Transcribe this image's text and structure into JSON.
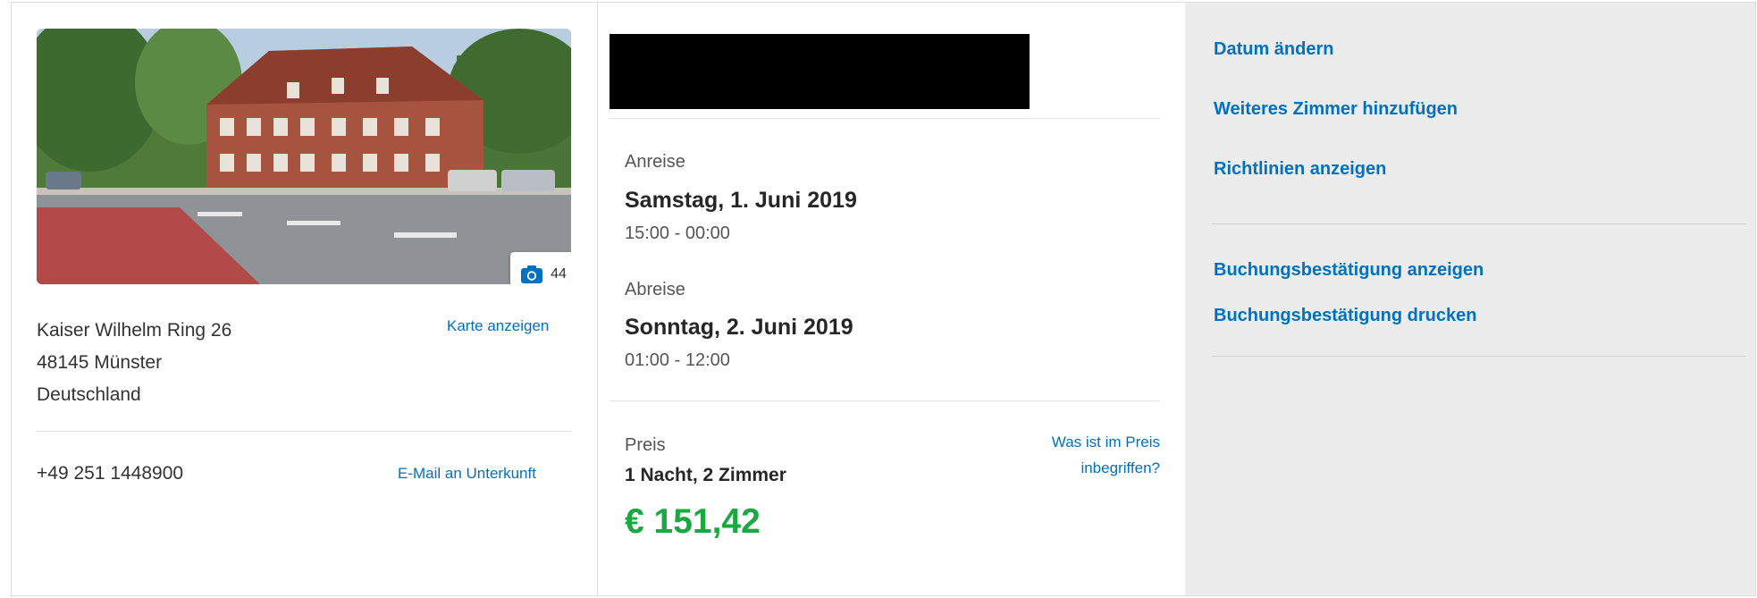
{
  "property": {
    "photo_count": "44",
    "address_lines": [
      "Kaiser Wilhelm Ring 26",
      "48145 Münster",
      "Deutschland"
    ],
    "map_link": "Karte anzeigen",
    "phone": "+49 251 1448900",
    "email_link": "E-Mail an Unterkunft"
  },
  "stay": {
    "checkin_label": "Anreise",
    "checkin_date": "Samstag, 1. Juni 2019",
    "checkin_time": "15:00 - 00:00",
    "checkout_label": "Abreise",
    "checkout_date": "Sonntag, 2. Juni 2019",
    "checkout_time": "01:00 - 12:00"
  },
  "price": {
    "label": "Preis",
    "nights_rooms": "1 Nacht, 2 Zimmer",
    "amount": "€ 151,42",
    "info_link_line1": "Was ist im Preis",
    "info_link_line2": "inbegriffen?",
    "amount_color": "#1aa842"
  },
  "actions": {
    "change_date": "Datum ändern",
    "add_room": "Weiteres Zimmer hinzufügen",
    "show_policies": "Richtlinien anzeigen",
    "show_confirmation": "Buchungsbestätigung anzeigen",
    "print_confirmation": "Buchungsbestätigung drucken"
  },
  "icons": {
    "photo": "camera-icon"
  },
  "colors": {
    "link": "#0071c2",
    "panel_bg": "#ececec"
  }
}
